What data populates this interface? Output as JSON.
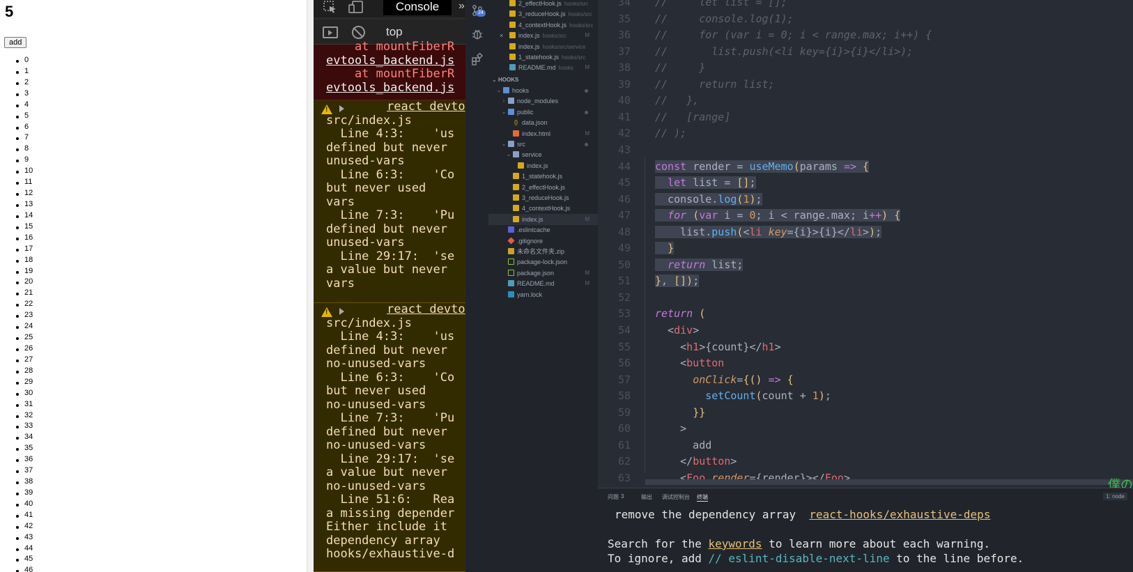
{
  "page": {
    "count": "5",
    "add_label": "add",
    "items": [
      "0",
      "1",
      "2",
      "3",
      "4",
      "5",
      "6",
      "7",
      "8",
      "9",
      "10",
      "11",
      "12",
      "13",
      "14",
      "15",
      "16",
      "17",
      "18",
      "19",
      "20",
      "21",
      "22",
      "23",
      "24",
      "25",
      "26",
      "27",
      "28",
      "29",
      "30",
      "31",
      "32",
      "33",
      "34",
      "35",
      "36",
      "37",
      "38",
      "39",
      "40",
      "41",
      "42",
      "43",
      "44",
      "45",
      "46"
    ]
  },
  "devtools": {
    "console_tab": "Console",
    "more": "»",
    "context": "top",
    "error_lines": [
      {
        "text": "    at mountFiberR",
        "cls": "err-text"
      },
      {
        "text": "evtools_backend.js",
        "cls": "file-link"
      },
      {
        "text": "    at mountFiberR",
        "cls": "err-text"
      },
      {
        "text": "evtools_backend.js",
        "cls": "file-link"
      }
    ],
    "warning1": {
      "link": "react devto",
      "lines": [
        "src/index.js",
        "  Line 4:3:    'us",
        "defined but never",
        "unused-vars",
        "  Line 6:3:    'Co",
        "but never used",
        "vars",
        "  Line 7:3:    'Pu",
        "defined but never",
        "unused-vars",
        "  Line 29:17:  'se",
        "a value but never",
        "vars"
      ]
    },
    "warning2": {
      "link": "react devto",
      "lines": [
        "src/index.js",
        "  Line 4:3:    'us",
        "defined but never",
        "no-unused-vars",
        "  Line 6:3:    'Co",
        "but never used",
        "no-unused-vars",
        "  Line 7:3:    'Pu",
        "defined but never",
        "no-unused-vars",
        "  Line 29:17:  'se",
        "a value but never",
        "no-unused-vars",
        "  Line 51:6:   Rea",
        "a missing depender",
        "Either include it",
        "dependency array",
        "hooks/exhaustive-d"
      ]
    }
  },
  "vscode": {
    "scm_badge": "24",
    "open_editors": [
      {
        "name": "2_effectHook.js",
        "desc": "hooks/src",
        "badge": "",
        "icon": "ic-js"
      },
      {
        "name": "3_reduceHook.js",
        "desc": "hooks/src",
        "badge": "",
        "icon": "ic-js"
      },
      {
        "name": "4_contextHook.js",
        "desc": "hooks/src",
        "badge": "",
        "icon": "ic-js"
      },
      {
        "name": "index.js",
        "desc": "hooks/src",
        "badge": "M",
        "icon": "ic-js"
      },
      {
        "name": "index.js",
        "desc": "hooks/src/service",
        "badge": "",
        "icon": "ic-js"
      },
      {
        "name": "1_statehook.js",
        "desc": "hooks/src",
        "badge": "",
        "icon": "ic-js"
      },
      {
        "name": "README.md",
        "desc": "hooks",
        "badge": "M",
        "icon": "ic-md"
      }
    ],
    "section_title": "HOOKS",
    "tree": [
      {
        "name": "hooks",
        "depth": 1,
        "chev": "⌄",
        "icon": "ic-folder-blue",
        "badge": "",
        "dot": true
      },
      {
        "name": "node_modules",
        "depth": 2,
        "chev": "›",
        "icon": "ic-folder",
        "badge": "",
        "dot": false
      },
      {
        "name": "public",
        "depth": 2,
        "chev": "⌄",
        "icon": "ic-folder-blue",
        "badge": "",
        "dot": true
      },
      {
        "name": "data.json",
        "depth": 3,
        "chev": "",
        "icon": "ic-json",
        "badge": "",
        "dot": false
      },
      {
        "name": "index.html",
        "depth": 3,
        "chev": "",
        "icon": "ic-html",
        "badge": "M",
        "dot": false
      },
      {
        "name": "src",
        "depth": 2,
        "chev": "⌄",
        "icon": "ic-folder",
        "badge": "",
        "dot": true
      },
      {
        "name": "service",
        "depth": 3,
        "chev": "⌄",
        "icon": "ic-folder",
        "badge": "",
        "dot": false
      },
      {
        "name": "index.js",
        "depth": 4,
        "chev": "",
        "icon": "ic-js",
        "badge": "",
        "dot": false
      },
      {
        "name": "1_statehook.js",
        "depth": 3,
        "chev": "",
        "icon": "ic-js",
        "badge": "",
        "dot": false
      },
      {
        "name": "2_effectHook.js",
        "depth": 3,
        "chev": "",
        "icon": "ic-js",
        "badge": "",
        "dot": false
      },
      {
        "name": "3_reduceHook.js",
        "depth": 3,
        "chev": "",
        "icon": "ic-js",
        "badge": "",
        "dot": false
      },
      {
        "name": "4_contextHook.js",
        "depth": 3,
        "chev": "",
        "icon": "ic-js",
        "badge": "",
        "dot": false
      },
      {
        "name": "index.js",
        "depth": 3,
        "chev": "",
        "icon": "ic-js",
        "badge": "M",
        "dot": false,
        "active": true
      },
      {
        "name": ".eslintcache",
        "depth": 2,
        "chev": "",
        "icon": "ic-eslint",
        "badge": "",
        "dot": false
      },
      {
        "name": ".gitignore",
        "depth": 2,
        "chev": "",
        "icon": "ic-git",
        "badge": "",
        "dot": false
      },
      {
        "name": "未命名文件夹.zip",
        "depth": 2,
        "chev": "",
        "icon": "ic-zip",
        "badge": "",
        "dot": false
      },
      {
        "name": "package-lock.json",
        "depth": 2,
        "chev": "",
        "icon": "ic-npm",
        "badge": "",
        "dot": false
      },
      {
        "name": "package.json",
        "depth": 2,
        "chev": "",
        "icon": "ic-npm",
        "badge": "M",
        "dot": false
      },
      {
        "name": "README.md",
        "depth": 2,
        "chev": "",
        "icon": "ic-md",
        "badge": "M",
        "dot": false
      },
      {
        "name": "yarn.lock",
        "depth": 2,
        "chev": "",
        "icon": "ic-yarn",
        "badge": "",
        "dot": false
      }
    ],
    "code": [
      {
        "n": "34",
        "sel": false,
        "t": [
          [
            "cm",
            "//     let list = [];"
          ]
        ]
      },
      {
        "n": "35",
        "sel": false,
        "t": [
          [
            "cm",
            "//     console.log(1);"
          ]
        ]
      },
      {
        "n": "36",
        "sel": false,
        "t": [
          [
            "cm",
            "//     for (var i = 0; i < range.max; i++) {"
          ]
        ]
      },
      {
        "n": "37",
        "sel": false,
        "t": [
          [
            "cm",
            "//       list.push(<li key={i}>{i}</li>);"
          ]
        ]
      },
      {
        "n": "38",
        "sel": false,
        "t": [
          [
            "cm",
            "//     }"
          ]
        ]
      },
      {
        "n": "39",
        "sel": false,
        "t": [
          [
            "cm",
            "//     return list;"
          ]
        ]
      },
      {
        "n": "40",
        "sel": false,
        "t": [
          [
            "cm",
            "//   },"
          ]
        ]
      },
      {
        "n": "41",
        "sel": false,
        "t": [
          [
            "cm",
            "//   [range]"
          ]
        ]
      },
      {
        "n": "42",
        "sel": false,
        "t": [
          [
            "cm",
            "// );"
          ]
        ]
      },
      {
        "n": "43",
        "sel": false,
        "t": [
          [
            "pu",
            ""
          ]
        ]
      },
      {
        "n": "44",
        "sel": true,
        "t": [
          [
            "kw",
            "const "
          ],
          [
            "pu",
            "render = "
          ],
          [
            "fn",
            "useMemo"
          ],
          [
            "br",
            "("
          ],
          [
            "pu",
            "params "
          ],
          [
            "kw",
            "=> "
          ],
          [
            "br",
            "{"
          ]
        ]
      },
      {
        "n": "45",
        "sel": true,
        "t": [
          [
            "pu",
            "  "
          ],
          [
            "kw",
            "let "
          ],
          [
            "pu",
            "list = "
          ],
          [
            "br",
            "[]"
          ],
          [
            "pu",
            ";"
          ]
        ]
      },
      {
        "n": "46",
        "sel": true,
        "t": [
          [
            "pu",
            "  console."
          ],
          [
            "fn",
            "log"
          ],
          [
            "br",
            "("
          ],
          [
            "nm",
            "1"
          ],
          [
            "br",
            ")"
          ],
          [
            "pu",
            ";"
          ]
        ]
      },
      {
        "n": "47",
        "sel": true,
        "t": [
          [
            "pu",
            "  "
          ],
          [
            "kwi",
            "for "
          ],
          [
            "br",
            "("
          ],
          [
            "kw",
            "var "
          ],
          [
            "pu",
            "i = "
          ],
          [
            "nm",
            "0"
          ],
          [
            "pu",
            "; i < range.max; i"
          ],
          [
            "kw",
            "++"
          ],
          [
            "br",
            ")"
          ],
          [
            "pu",
            " "
          ],
          [
            "br",
            "{"
          ]
        ]
      },
      {
        "n": "48",
        "sel": true,
        "t": [
          [
            "pu",
            "    list."
          ],
          [
            "fn",
            "push"
          ],
          [
            "br",
            "("
          ],
          [
            "pu",
            "<"
          ],
          [
            "tg",
            "li "
          ],
          [
            "at",
            "key"
          ],
          [
            "pu",
            "={i}>{i}</"
          ],
          [
            "tg",
            "li"
          ],
          [
            "pu",
            ">"
          ],
          [
            "br",
            ")"
          ],
          [
            "pu",
            ";"
          ]
        ]
      },
      {
        "n": "49",
        "sel": true,
        "t": [
          [
            "pu",
            "  "
          ],
          [
            "br",
            "}"
          ]
        ]
      },
      {
        "n": "50",
        "sel": true,
        "t": [
          [
            "pu",
            "  "
          ],
          [
            "kwi",
            "return "
          ],
          [
            "pu",
            "list;"
          ]
        ]
      },
      {
        "n": "51",
        "sel": true,
        "t": [
          [
            "br",
            "}"
          ],
          [
            "pu",
            ", "
          ],
          [
            "br",
            "[]"
          ],
          [
            "br",
            ")"
          ],
          [
            "pu",
            ";"
          ]
        ]
      },
      {
        "n": "52",
        "sel": false,
        "t": [
          [
            "pu",
            ""
          ]
        ]
      },
      {
        "n": "53",
        "sel": false,
        "t": [
          [
            "kwi",
            "return "
          ],
          [
            "br",
            "("
          ]
        ]
      },
      {
        "n": "54",
        "sel": false,
        "t": [
          [
            "pu",
            "  <"
          ],
          [
            "tg",
            "div"
          ],
          [
            "pu",
            ">"
          ]
        ]
      },
      {
        "n": "55",
        "sel": false,
        "t": [
          [
            "pu",
            "    <"
          ],
          [
            "tg",
            "h1"
          ],
          [
            "pu",
            ">{count}</"
          ],
          [
            "tg",
            "h1"
          ],
          [
            "pu",
            ">"
          ]
        ]
      },
      {
        "n": "56",
        "sel": false,
        "t": [
          [
            "pu",
            "    <"
          ],
          [
            "tg",
            "button"
          ]
        ]
      },
      {
        "n": "57",
        "sel": false,
        "t": [
          [
            "pu",
            "      "
          ],
          [
            "at",
            "onClick"
          ],
          [
            "pu",
            "="
          ],
          [
            "br",
            "{() "
          ],
          [
            "kw",
            "=> "
          ],
          [
            "br",
            "{"
          ]
        ]
      },
      {
        "n": "58",
        "sel": false,
        "t": [
          [
            "pu",
            "        "
          ],
          [
            "fn",
            "setCount"
          ],
          [
            "br",
            "("
          ],
          [
            "pu",
            "count + "
          ],
          [
            "nm",
            "1"
          ],
          [
            "br",
            ")"
          ],
          [
            "pu",
            ";"
          ]
        ]
      },
      {
        "n": "59",
        "sel": false,
        "t": [
          [
            "pu",
            "      "
          ],
          [
            "br",
            "}}"
          ]
        ]
      },
      {
        "n": "60",
        "sel": false,
        "t": [
          [
            "pu",
            "    >"
          ]
        ]
      },
      {
        "n": "61",
        "sel": false,
        "t": [
          [
            "pu",
            "      add"
          ]
        ]
      },
      {
        "n": "62",
        "sel": false,
        "t": [
          [
            "pu",
            "    </"
          ],
          [
            "tg",
            "button"
          ],
          [
            "pu",
            ">"
          ]
        ]
      },
      {
        "n": "63",
        "sel": false,
        "t": [
          [
            "pu",
            "    <"
          ],
          [
            "tg",
            "Foo "
          ],
          [
            "at",
            "render"
          ],
          [
            "pu",
            "={render}></"
          ],
          [
            "tg",
            "Foo"
          ],
          [
            "pu",
            ">"
          ]
        ]
      }
    ],
    "jp_text": "僕の",
    "panel": {
      "tabs": [
        "问题",
        "输出",
        "调试控制台",
        "终端"
      ],
      "problem_count": "3",
      "terminal_select": "1: node",
      "line1_pre": "remove the dependency array  ",
      "line1_link": "react-hooks/exhaustive-deps",
      "line2_pre": "Search for the ",
      "line2_kw": "keywords",
      "line2_post": " to learn more about each warning.",
      "line3_pre": "To ignore, add ",
      "line3_cmd": "// eslint-disable-next-line",
      "line3_post": " to the line before."
    }
  }
}
